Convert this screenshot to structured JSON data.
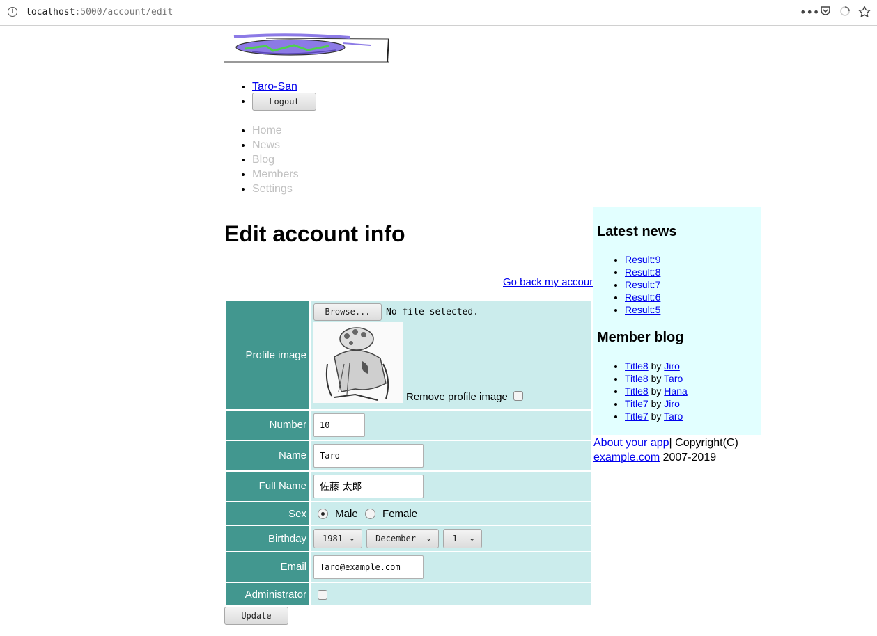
{
  "browser": {
    "url_host": "localhost",
    "url_rest": ":5000/account/edit"
  },
  "user": {
    "name": "Taro-San",
    "logout_label": "Logout"
  },
  "nav": [
    "Home",
    "News",
    "Blog",
    "Members",
    "Settings"
  ],
  "page": {
    "title": "Edit account info",
    "go_back": "Go back my account"
  },
  "form": {
    "profile_image": {
      "label": "Profile image",
      "browse_label": "Browse...",
      "file_status": "No file selected.",
      "remove_label": "Remove profile image",
      "remove_checked": false
    },
    "number": {
      "label": "Number",
      "value": "10"
    },
    "name": {
      "label": "Name",
      "value": "Taro"
    },
    "full_name": {
      "label": "Full Name",
      "value": "佐藤 太郎"
    },
    "sex": {
      "label": "Sex",
      "options": [
        "Male",
        "Female"
      ],
      "selected": "Male"
    },
    "birthday": {
      "label": "Birthday",
      "year": "1981",
      "month": "December",
      "day": "1"
    },
    "email": {
      "label": "Email",
      "value": "Taro@example.com"
    },
    "administrator": {
      "label": "Administrator",
      "checked": false
    },
    "update_label": "Update"
  },
  "sidebar": {
    "news_title": "Latest news",
    "news": [
      "Result:9",
      "Result:8",
      "Result:7",
      "Result:6",
      "Result:5"
    ],
    "blog_title": "Member blog",
    "by_text": "by",
    "blog": [
      {
        "title": "Title8",
        "author": "Jiro"
      },
      {
        "title": "Title8",
        "author": "Taro"
      },
      {
        "title": "Title8",
        "author": "Hana"
      },
      {
        "title": "Title7",
        "author": "Jiro"
      },
      {
        "title": "Title7",
        "author": "Taro"
      }
    ]
  },
  "footer": {
    "about": "About your app",
    "copyright": "| Copyright(C)",
    "site": "example.com",
    "years": " 2007-2019"
  },
  "colors": {
    "label_bg": "#42978f",
    "value_bg": "#cbecec",
    "sidebar_bg": "#e2ffff",
    "link": "#0000ee"
  }
}
